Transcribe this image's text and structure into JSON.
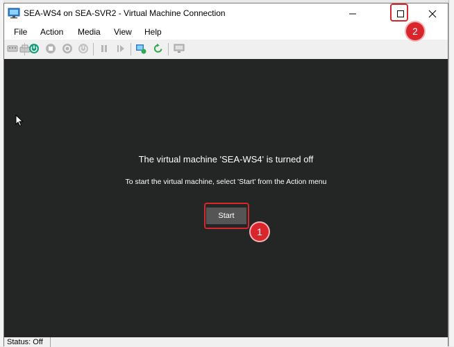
{
  "window": {
    "title": "SEA-WS4 on SEA-SVR2 - Virtual Machine Connection"
  },
  "menu": [
    "File",
    "Action",
    "Media",
    "View",
    "Help"
  ],
  "toolbar": {
    "icons": [
      "ctrl-alt-del-icon",
      "type-clipboard-icon",
      "start-icon",
      "turn-off-icon",
      "shut-down-icon",
      "power-icon",
      "pause-icon",
      "resume-icon",
      "checkpoint-icon",
      "revert-icon",
      "enhanced-session-icon"
    ]
  },
  "screen": {
    "headline": "The virtual machine 'SEA-WS4' is turned off",
    "subline": "To start the virtual machine, select 'Start' from the Action menu",
    "start_label": "Start"
  },
  "callouts": {
    "one": "1",
    "two": "2"
  },
  "status": {
    "text": "Status: Off"
  },
  "colors": {
    "screen_bg": "#232624",
    "highlight": "#d9262d",
    "start_icon": "#1a9e7e"
  }
}
